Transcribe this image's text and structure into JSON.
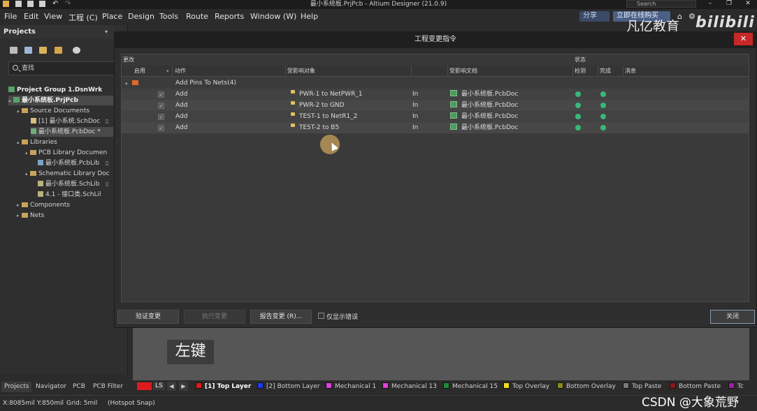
{
  "window": {
    "title": "最小系统板.PrjPcb - Altium Designer (21.0.9)",
    "search_placeholder": "Search"
  },
  "menu": {
    "items": [
      "File",
      "Edit",
      "View",
      "工程 (C)",
      "Place",
      "Design",
      "Tools",
      "Route",
      "Reports",
      "Window (W)",
      "Help"
    ],
    "share_label": "分享",
    "buy_label": "立即在线购买"
  },
  "watermark": {
    "brand": "凡亿教育",
    "logo_text": "bilibili",
    "csdn": "CSDN @大象荒野"
  },
  "projects_panel": {
    "title": "Projects",
    "search_placeholder": "查找",
    "tree": [
      {
        "label": "Project Group 1.DsnWrk",
        "level": 0,
        "bold": true,
        "icon": "project-group-icon"
      },
      {
        "label": "最小系统板.PrjPcb",
        "level": 0,
        "bold": true,
        "icon": "pcb-project-icon",
        "selected": true
      },
      {
        "label": "Source Documents",
        "level": 1,
        "icon": "folder-icon"
      },
      {
        "label": "[1] 最小系统.SchDoc",
        "level": 2,
        "icon": "schdoc-icon"
      },
      {
        "label": "最小系统板.PcbDoc *",
        "level": 2,
        "icon": "pcbdoc-icon",
        "selected": true
      },
      {
        "label": "Libraries",
        "level": 1,
        "icon": "folder-icon"
      },
      {
        "label": "PCB Library Documen",
        "level": 2,
        "icon": "folder-icon"
      },
      {
        "label": "最小系统板.PcbLib",
        "level": 3,
        "icon": "pcblib-icon"
      },
      {
        "label": "Schematic Library Doc",
        "level": 2,
        "icon": "folder-icon"
      },
      {
        "label": "最小系统板.SchLib",
        "level": 3,
        "icon": "schlib-icon"
      },
      {
        "label": "4.1    - 接口类.SchLil",
        "level": 3,
        "icon": "schlib-icon"
      },
      {
        "label": "Components",
        "level": 1,
        "icon": "folder-icon"
      },
      {
        "label": "Nets",
        "level": 1,
        "icon": "folder-icon"
      }
    ],
    "tabs": [
      "Projects",
      "Navigator",
      "PCB",
      "PCB Filter"
    ]
  },
  "dialog": {
    "title": "工程变更指令",
    "section_changes": "更改",
    "section_status": "状态",
    "columns": {
      "enable": "启用",
      "action": "动作",
      "affected_object": "受影响对象",
      "affected_document": "受影响文档",
      "check": "检测",
      "done": "完成",
      "message": "消息"
    },
    "group": {
      "label": "Add Pins To Nets(4)"
    },
    "rows": [
      {
        "enabled": true,
        "action": "Add",
        "object": "PWR-1 to NetPWR_1",
        "in": "In",
        "document": "最小系统板.PcbDoc",
        "check_ok": true,
        "done_ok": true
      },
      {
        "enabled": true,
        "action": "Add",
        "object": "PWR-2 to GND",
        "in": "In",
        "document": "最小系统板.PcbDoc",
        "check_ok": true,
        "done_ok": true
      },
      {
        "enabled": true,
        "action": "Add",
        "object": "TEST-1 to NetR1_2",
        "in": "In",
        "document": "最小系统板.PcbDoc",
        "check_ok": true,
        "done_ok": true
      },
      {
        "enabled": true,
        "action": "Add",
        "object": "TEST-2 to B5",
        "in": "In",
        "document": "最小系统板.PcbDoc",
        "check_ok": true,
        "done_ok": true
      }
    ],
    "buttons": {
      "validate": "验证变更",
      "execute": "执行变更",
      "report": "报告变更 (R)...",
      "only_errors": "仅显示错误",
      "close": "关闭"
    }
  },
  "canvas": {
    "overlay_key": "左键"
  },
  "layers": {
    "current_short": "LS",
    "items": [
      {
        "label": "[1] Top Layer",
        "color": "#e01b1b",
        "active": true
      },
      {
        "label": "[2] Bottom Layer",
        "color": "#1e3cf0"
      },
      {
        "label": "Mechanical 1",
        "color": "#e040e0"
      },
      {
        "label": "Mechanical 13",
        "color": "#e040e0"
      },
      {
        "label": "Mechanical 15",
        "color": "#1f8a3a"
      },
      {
        "label": "Top Overlay",
        "color": "#f0e020"
      },
      {
        "label": "Bottom Overlay",
        "color": "#8a8a20"
      },
      {
        "label": "Top Paste",
        "color": "#7a7a7a"
      },
      {
        "label": "Bottom Paste",
        "color": "#8a1a1a"
      },
      {
        "label": "Tc",
        "color": "#a020a0"
      }
    ]
  },
  "status": {
    "coords": "X:8085mil Y:850mil",
    "grid": "Grid: 5mil",
    "snap": "(Hotspot Snap)"
  }
}
